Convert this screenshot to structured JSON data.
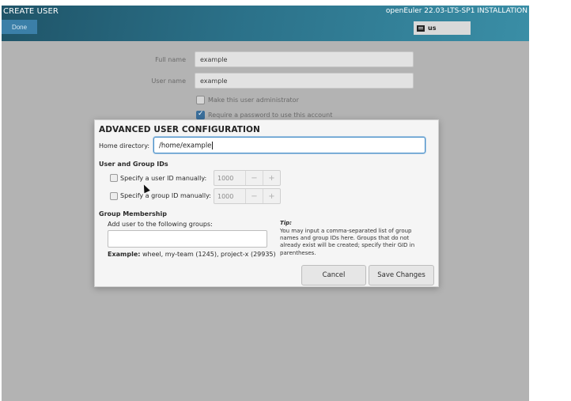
{
  "header": {
    "title": "CREATE USER",
    "done_label": "Done",
    "installer_title": "openEuler 22.03-LTS-SP1 INSTALLATION",
    "keyboard_layout": "us"
  },
  "form": {
    "full_name_label": "Full name",
    "full_name_value": "example",
    "user_name_label": "User name",
    "user_name_value": "example",
    "admin_label": "Make this user administrator",
    "password_label": "Require a password to use this account"
  },
  "dialog": {
    "title": "ADVANCED USER CONFIGURATION",
    "home_label": "Home directory:",
    "home_value": "/home/example",
    "ids_section": "User and Group IDs",
    "uid_label": "Specify a user ID manually:",
    "uid_value": "1000",
    "gid_label": "Specify a group ID manually:",
    "gid_value": "1000",
    "minus_glyph": "−",
    "plus_glyph": "+",
    "membership_section": "Group Membership",
    "groups_label": "Add user to the following groups:",
    "groups_value": "",
    "example_prefix": "Example:",
    "example_text": "wheel, my-team (1245), project-x (29935)",
    "tip_title": "Tip:",
    "tip_text": "You may input a comma-separated list of group names and group IDs here. Groups that do not already exist will be created; specify their GID in parentheses.",
    "cancel_label": "Cancel",
    "save_label": "Save Changes"
  },
  "colors": {
    "header_start": "#1f5468",
    "header_end": "#3a8ea6",
    "focus_border": "#4a90c8"
  }
}
